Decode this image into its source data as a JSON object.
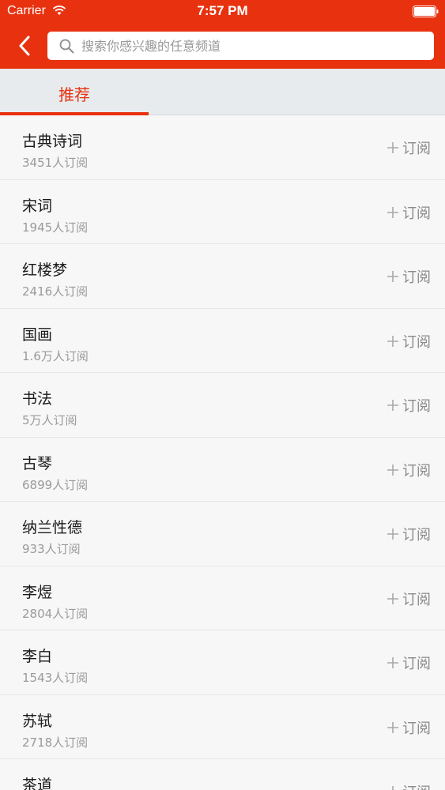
{
  "status_bar": {
    "carrier": "Carrier",
    "time": "7:57 PM"
  },
  "search": {
    "placeholder": "搜索你感兴趣的任意频道"
  },
  "tabs": [
    {
      "label": "推荐",
      "active": true
    }
  ],
  "subscribe_label": "订阅",
  "channels": [
    {
      "name": "古典诗词",
      "count": "3451人订阅"
    },
    {
      "name": "宋词",
      "count": "1945人订阅"
    },
    {
      "name": "红楼梦",
      "count": "2416人订阅"
    },
    {
      "name": "国画",
      "count": "1.6万人订阅"
    },
    {
      "name": "书法",
      "count": "5万人订阅"
    },
    {
      "name": "古琴",
      "count": "6899人订阅"
    },
    {
      "name": "纳兰性德",
      "count": "933人订阅"
    },
    {
      "name": "李煜",
      "count": "2804人订阅"
    },
    {
      "name": "李白",
      "count": "1543人订阅"
    },
    {
      "name": "苏轼",
      "count": "2718人订阅"
    },
    {
      "name": "茶道",
      "count": ""
    }
  ],
  "colors": {
    "brand": "#e8320f",
    "tab_bar": "#e7ebee",
    "list_background": "#f7f7f8"
  },
  "icons": [
    "wifi-icon",
    "battery-icon",
    "back-chevron-icon",
    "search-icon",
    "plus-icon"
  ]
}
